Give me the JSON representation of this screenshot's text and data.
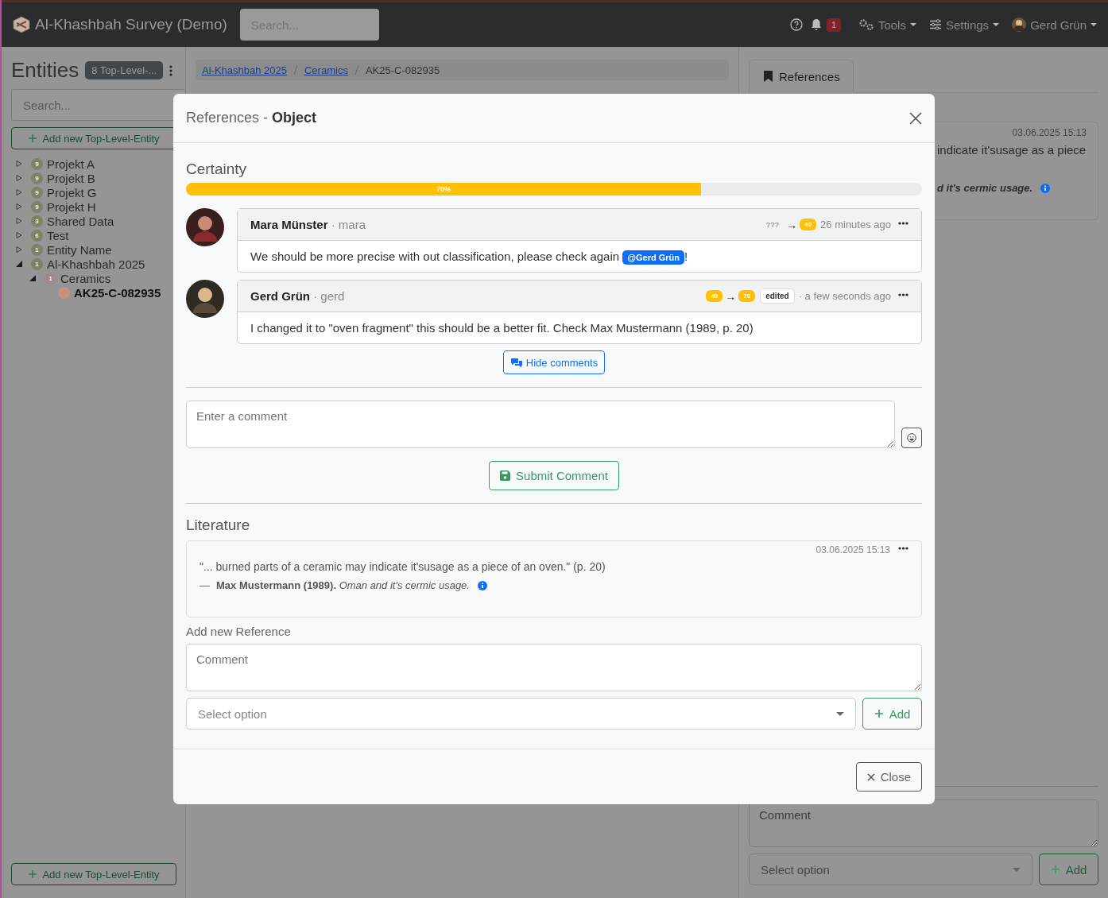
{
  "navbar": {
    "brand": "Al-Khashbah Survey (Demo)",
    "search": {
      "placeholder": "Search..."
    },
    "notifications": "1",
    "tools": "Tools",
    "settings": "Settings",
    "user": "Gerd Grün"
  },
  "sidebar": {
    "title": "Entities",
    "badge": "8 Top-Level-...",
    "search": {
      "placeholder": "Search..."
    },
    "add_button": "Add new Top-Level-Entity",
    "tree": [
      {
        "label": "Projekt A",
        "count": "9",
        "color": "#7b8466",
        "expanded": false,
        "selected": false
      },
      {
        "label": "Projekt B",
        "count": "9",
        "color": "#7b8466",
        "expanded": false,
        "selected": false
      },
      {
        "label": "Projekt G",
        "count": "9",
        "color": "#7b8466",
        "expanded": false,
        "selected": false
      },
      {
        "label": "Projekt H",
        "count": "9",
        "color": "#7b8466",
        "expanded": false,
        "selected": false
      },
      {
        "label": "Shared Data",
        "count": "3",
        "color": "#7b8466",
        "expanded": false,
        "selected": false
      },
      {
        "label": "Test",
        "count": "6",
        "color": "#7b8466",
        "expanded": false,
        "selected": false
      },
      {
        "label": "Entity Name",
        "count": "1",
        "color": "#7b8466",
        "expanded": false,
        "selected": false
      },
      {
        "label": "Al-Khashbah 2025",
        "count": "1",
        "color": "#7b8466",
        "expanded": true,
        "selected": false,
        "children": [
          {
            "label": "Ceramics",
            "count": "1",
            "color": "#a8848c",
            "expanded": true,
            "selected": false,
            "children": [
              {
                "label": "AK25-C-082935",
                "color": "#c8907f",
                "selected": true
              }
            ]
          }
        ]
      }
    ],
    "bottom_button": "Add new Top-Level-Entity"
  },
  "breadcrumb": [
    {
      "label": "Al-Khashbah 2025",
      "link": true
    },
    {
      "label": "Ceramics",
      "link": true
    },
    {
      "label": "AK25-C-082935",
      "link": false
    }
  ],
  "references_panel": {
    "tab": {
      "label": "References",
      "selected": true
    },
    "card": {
      "date": "03.06.2025 15:13",
      "quote": "indicate it'susage as a piece",
      "citation": "d it's cermic usage."
    },
    "comment": {
      "placeholder": "Comment"
    },
    "select": {
      "placeholder": "Select option"
    },
    "add_button": "Add"
  },
  "modal": {
    "title": "References - **Object**",
    "certainty": {
      "label": "Certainty",
      "level": 0.7,
      "reading": "70%"
    },
    "comments": [
      {
        "byline": "**Mara Münster** · mara",
        "from": "???",
        "from_set": false,
        "arrow": "→",
        "to": "40",
        "edited": false,
        "time": "26 minutes ago",
        "text": "We should be more precise with out classification, please check again ",
        "mention": "@Gerd Grün",
        "after": "!"
      },
      {
        "byline": "**Gerd Grün** · gerd",
        "from": "40",
        "from_set": true,
        "arrow": "→",
        "to": "70",
        "edited": true,
        "edited_label": "edited",
        "time": "· a few seconds ago",
        "text": "I changed it to \"oven fragment\" this should be a better fit. Check Max Mustermann (1989, p. 20)"
      }
    ],
    "hide_comments": "Hide comments",
    "comment_field": {
      "placeholder": "Enter a comment"
    },
    "submit": "Submit Comment",
    "literature": {
      "heading": "Literature",
      "date": "03.06.2025 15:13",
      "quote": "\"... burned parts of a ceramic may indicate it'susage as a piece of an oven.\" (p. 20)",
      "dash": "—",
      "citation": "**Max Mustermann (1989).** *Oman and it's cermic usage.*"
    },
    "add_reference": {
      "label": "Add new Reference",
      "comment": {
        "placeholder": "Comment"
      },
      "select": {
        "placeholder": "Select option"
      },
      "add_button": "Add"
    },
    "close": "Close"
  }
}
